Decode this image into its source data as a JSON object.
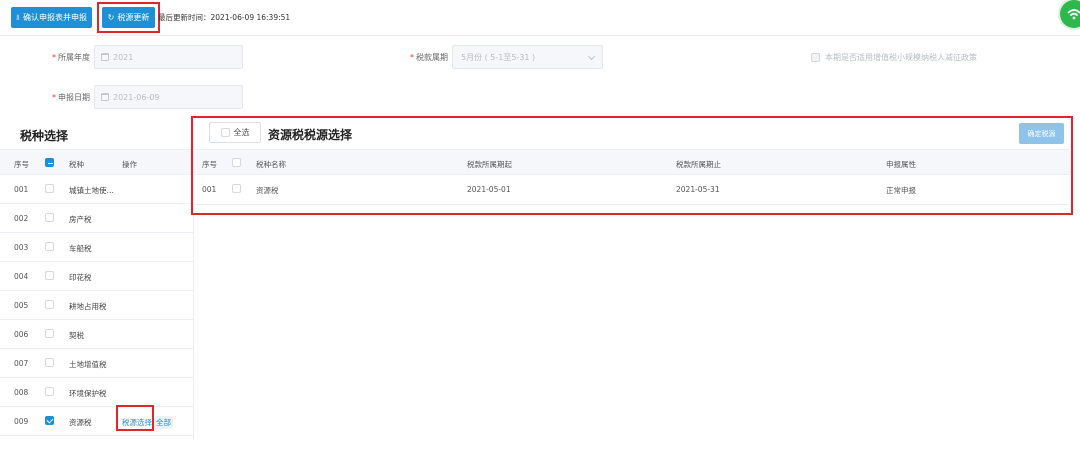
{
  "toolbar": {
    "confirm_submit_label": "确认申报表并申报",
    "refresh_label": "税源更新",
    "last_update_label": "最后更新时间：",
    "last_update_value": "2021-06-09 16:39:51"
  },
  "form": {
    "year_label": "所属年度",
    "year_value": "2021",
    "period_label": "税款属期",
    "period_value": "5月份 ( 5-1至5-31 )",
    "small_taxpayer_label": "本期是否适用增值税小规模纳税人减征政策",
    "date_label": "申报日期",
    "date_value": "2021-06-09"
  },
  "left_panel": {
    "title": "税种选择",
    "headers": {
      "seq": "序号",
      "tax": "税种",
      "op": "操作"
    },
    "rows": [
      {
        "seq": "001",
        "tax": "城镇土地使…",
        "checked": false
      },
      {
        "seq": "002",
        "tax": "房产税",
        "checked": false
      },
      {
        "seq": "003",
        "tax": "车船税",
        "checked": false
      },
      {
        "seq": "004",
        "tax": "印花税",
        "checked": false
      },
      {
        "seq": "005",
        "tax": "耕地占用税",
        "checked": false
      },
      {
        "seq": "006",
        "tax": "契税",
        "checked": false
      },
      {
        "seq": "007",
        "tax": "土地增值税",
        "checked": false
      },
      {
        "seq": "008",
        "tax": "环境保护税",
        "checked": false
      },
      {
        "seq": "009",
        "tax": "资源税",
        "checked": true,
        "op_link": "税源选择",
        "op_tag": "全部"
      }
    ]
  },
  "right_panel": {
    "select_all_label": "全选",
    "title": "资源税税源选择",
    "confirm_label": "确定税源",
    "headers": {
      "seq": "序号",
      "name": "税种名称",
      "start": "税款所属期起",
      "end": "税款所属期止",
      "attr": "申报属性"
    },
    "rows": [
      {
        "seq": "001",
        "name": "资源税",
        "start": "2021-05-01",
        "end": "2021-05-31",
        "attr": "正常申报"
      }
    ]
  },
  "colors": {
    "primary": "#1f8fd6",
    "highlight_box": "#e0262d",
    "wifi_icon": "#2db84d"
  },
  "icons": {
    "confirm_submit": "submit-icon",
    "refresh": "refresh-icon",
    "calendar": "calendar-icon",
    "wifi": "wifi-icon"
  }
}
